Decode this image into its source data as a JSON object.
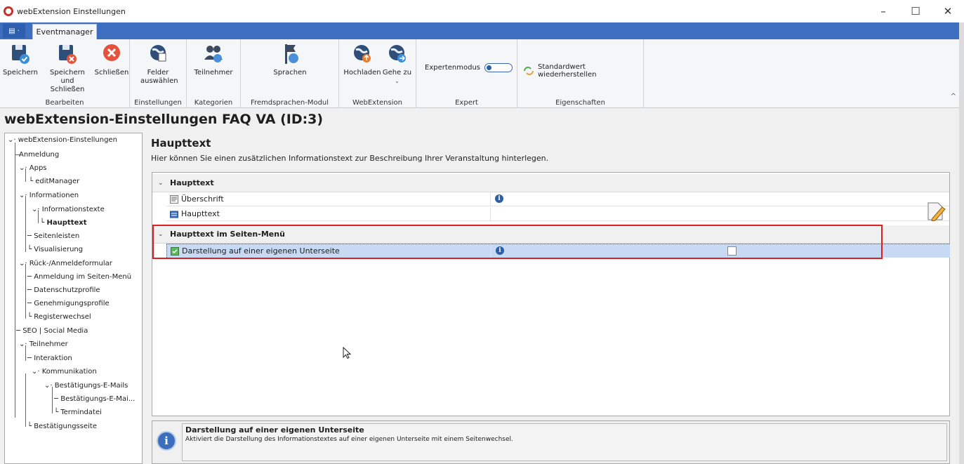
{
  "window": {
    "title": "webExtension Einstellungen",
    "minimize": "–",
    "maximize": "☐",
    "close": "✕"
  },
  "tabs": {
    "appmenu": "▤ ·",
    "active": "Eventmanager"
  },
  "ribbon": {
    "groups": [
      {
        "label": "Bearbeiten",
        "buttons": [
          "Speichern",
          "Speichern und Schließen",
          "Schließen"
        ]
      },
      {
        "label": "Einstellungen",
        "buttons": [
          "Felder auswählen"
        ]
      },
      {
        "label": "Kategorien",
        "buttons": [
          "Teilnehmer"
        ]
      },
      {
        "label": "Fremdsprachen-Modul",
        "buttons": [
          "Sprachen"
        ]
      },
      {
        "label": "WebExtension",
        "buttons": [
          "Hochladen",
          "Gehe zu"
        ]
      },
      {
        "label": "Expert",
        "buttons": [
          "Expertenmodus"
        ]
      },
      {
        "label": "Eigenschaften",
        "buttons": [
          "Standardwert wiederherstellen"
        ]
      }
    ],
    "collapse": "^"
  },
  "page_title": "webExtension-Einstellungen FAQ VA (ID:3)",
  "tree": [
    {
      "label": "webExtension-Einstellungen",
      "bold": false
    },
    {
      "label": "Anmeldung",
      "bold": false
    },
    {
      "label": "Apps",
      "bold": false
    },
    {
      "label": "editManager",
      "bold": false
    },
    {
      "label": "Informationen",
      "bold": false
    },
    {
      "label": "Informationstexte",
      "bold": false
    },
    {
      "label": "Haupttext",
      "bold": true
    },
    {
      "label": "Seitenleisten",
      "bold": false
    },
    {
      "label": "Visualisierung",
      "bold": false
    },
    {
      "label": "Rück-/Anmeldeformular",
      "bold": false
    },
    {
      "label": "Anmeldung im Seiten-Menü",
      "bold": false
    },
    {
      "label": "Datenschutzprofile",
      "bold": false
    },
    {
      "label": "Genehmigungsprofile",
      "bold": false
    },
    {
      "label": "Registerwechsel",
      "bold": false
    },
    {
      "label": "SEO | Social Media",
      "bold": false
    },
    {
      "label": "Teilnehmer",
      "bold": false
    },
    {
      "label": "Interaktion",
      "bold": false
    },
    {
      "label": "Kommunikation",
      "bold": false
    },
    {
      "label": "Bestätigungs-E-Mails",
      "bold": false
    },
    {
      "label": "Bestätigungs-E-Mai...",
      "bold": false
    },
    {
      "label": "Termindatei",
      "bold": false
    },
    {
      "label": "Bestätigungsseite",
      "bold": false
    }
  ],
  "main": {
    "heading": "Haupttext",
    "description": "Hier können Sie einen zusätzlichen Informationstext zur Beschreibung Ihrer Veranstaltung hinterlegen.",
    "categories": [
      {
        "label": "Haupttext",
        "rows": [
          "Überschrift",
          "Haupttext"
        ]
      },
      {
        "label": "Haupttext im Seiten-Menü",
        "rows": [
          "Darstellung auf einer eigenen Unterseite"
        ]
      }
    ],
    "info_glyph": "i",
    "checkbox_checked": false
  },
  "help": {
    "title": "Darstellung auf einer eigenen Unterseite",
    "text": "Aktiviert die Darstellung des Informationstextes auf einer eigenen Unterseite mit einem Seitenwechsel."
  },
  "colors": {
    "accent": "#3d6ebf",
    "highlight": "#e02020",
    "selected": "#c7d9f3"
  }
}
